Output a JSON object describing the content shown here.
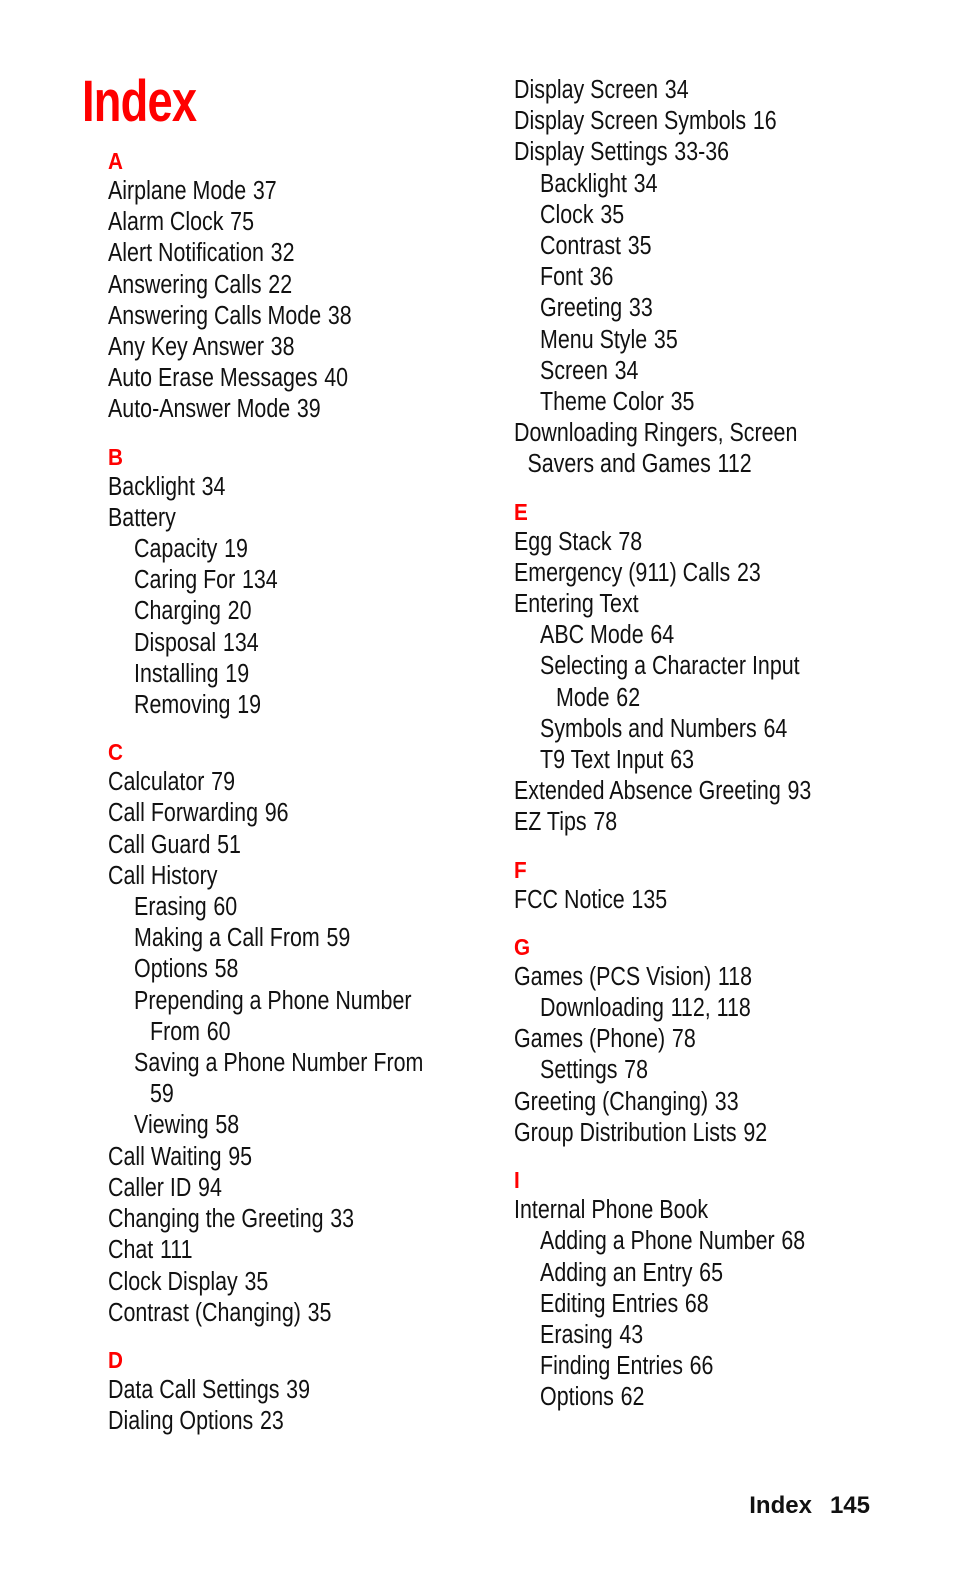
{
  "page": {
    "title": "Index",
    "accent_color": "#ff0000",
    "footer": {
      "section": "Index",
      "page_number": "145"
    }
  },
  "left_column": [
    {
      "letter": "A",
      "entries": [
        {
          "term": "Airplane Mode",
          "pages": "37",
          "level": 0
        },
        {
          "term": "Alarm Clock",
          "pages": "75",
          "level": 0
        },
        {
          "term": "Alert Notification",
          "pages": "32",
          "level": 0
        },
        {
          "term": "Answering Calls",
          "pages": "22",
          "level": 0
        },
        {
          "term": "Answering Calls Mode",
          "pages": "38",
          "level": 0
        },
        {
          "term": "Any Key Answer",
          "pages": "38",
          "level": 0
        },
        {
          "term": "Auto Erase Messages",
          "pages": "40",
          "level": 0
        },
        {
          "term": "Auto-Answer Mode",
          "pages": "39",
          "level": 0
        }
      ]
    },
    {
      "letter": "B",
      "entries": [
        {
          "term": "Backlight",
          "pages": "34",
          "level": 0
        },
        {
          "term": "Battery",
          "pages": "",
          "level": 0
        },
        {
          "term": "Capacity",
          "pages": "19",
          "level": 1
        },
        {
          "term": "Caring For",
          "pages": "134",
          "level": 1
        },
        {
          "term": "Charging",
          "pages": "20",
          "level": 1
        },
        {
          "term": "Disposal",
          "pages": "134",
          "level": 1
        },
        {
          "term": "Installing",
          "pages": "19",
          "level": 1
        },
        {
          "term": "Removing",
          "pages": "19",
          "level": 1
        }
      ]
    },
    {
      "letter": "C",
      "entries": [
        {
          "term": "Calculator",
          "pages": "79",
          "level": 0
        },
        {
          "term": "Call Forwarding",
          "pages": "96",
          "level": 0
        },
        {
          "term": "Call Guard",
          "pages": "51",
          "level": 0
        },
        {
          "term": "Call History",
          "pages": "",
          "level": 0
        },
        {
          "term": "Erasing",
          "pages": "60",
          "level": 1
        },
        {
          "term": "Making a Call From",
          "pages": "59",
          "level": 1
        },
        {
          "term": "Options",
          "pages": "58",
          "level": 1
        },
        {
          "term": "Prepending a Phone Number",
          "cont": "From",
          "pages": "60",
          "level": 1
        },
        {
          "term": "Saving a Phone Number From",
          "cont": "",
          "pages": "59",
          "level": 1
        },
        {
          "term": "Viewing",
          "pages": "58",
          "level": 1
        },
        {
          "term": "Call Waiting",
          "pages": "95",
          "level": 0
        },
        {
          "term": "Caller ID",
          "pages": "94",
          "level": 0
        },
        {
          "term": "Changing the Greeting",
          "pages": "33",
          "level": 0
        },
        {
          "term": "Chat",
          "pages": "111",
          "level": 0
        },
        {
          "term": "Clock Display",
          "pages": "35",
          "level": 0
        },
        {
          "term": "Contrast (Changing)",
          "pages": "35",
          "level": 0
        }
      ]
    },
    {
      "letter": "D",
      "entries": [
        {
          "term": "Data Call Settings",
          "pages": "39",
          "level": 0
        },
        {
          "term": "Dialing Options",
          "pages": "23",
          "level": 0
        }
      ]
    }
  ],
  "right_column": [
    {
      "letter": "",
      "entries": [
        {
          "term": "Display Screen",
          "pages": "34",
          "level": 0
        },
        {
          "term": "Display Screen Symbols",
          "pages": "16",
          "level": 0
        },
        {
          "term": "Display Settings",
          "pages": "33-36",
          "level": 0
        },
        {
          "term": "Backlight",
          "pages": "34",
          "level": 1
        },
        {
          "term": "Clock",
          "pages": "35",
          "level": 1
        },
        {
          "term": "Contrast",
          "pages": "35",
          "level": 1
        },
        {
          "term": "Font",
          "pages": "36",
          "level": 1
        },
        {
          "term": "Greeting",
          "pages": "33",
          "level": 1
        },
        {
          "term": "Menu Style",
          "pages": "35",
          "level": 1
        },
        {
          "term": "Screen",
          "pages": "34",
          "level": 1
        },
        {
          "term": "Theme Color",
          "pages": "35",
          "level": 1
        },
        {
          "term": "Downloading Ringers, Screen",
          "cont": "Savers and Games",
          "pages": "112",
          "level": 0
        }
      ]
    },
    {
      "letter": "E",
      "entries": [
        {
          "term": "Egg Stack",
          "pages": "78",
          "level": 0
        },
        {
          "term": "Emergency (911) Calls",
          "pages": "23",
          "level": 0
        },
        {
          "term": "Entering Text",
          "pages": "",
          "level": 0
        },
        {
          "term": "ABC Mode",
          "pages": "64",
          "level": 1
        },
        {
          "term": "Selecting a Character Input",
          "cont": "Mode",
          "pages": "62",
          "level": 1
        },
        {
          "term": "Symbols and Numbers",
          "pages": "64",
          "level": 1
        },
        {
          "term": "T9 Text Input",
          "pages": "63",
          "level": 1
        },
        {
          "term": "Extended Absence Greeting",
          "pages": "93",
          "level": 0
        },
        {
          "term": "EZ Tips",
          "pages": "78",
          "level": 0
        }
      ]
    },
    {
      "letter": "F",
      "entries": [
        {
          "term": "FCC Notice",
          "pages": "135",
          "level": 0
        }
      ]
    },
    {
      "letter": "G",
      "entries": [
        {
          "term": "Games (PCS Vision)",
          "pages": "118",
          "level": 0
        },
        {
          "term": "Downloading",
          "pages": "112, 118",
          "level": 1
        },
        {
          "term": "Games (Phone)",
          "pages": "78",
          "level": 0
        },
        {
          "term": "Settings",
          "pages": "78",
          "level": 1
        },
        {
          "term": "Greeting (Changing)",
          "pages": "33",
          "level": 0
        },
        {
          "term": "Group Distribution Lists",
          "pages": "92",
          "level": 0
        }
      ]
    },
    {
      "letter": "I",
      "entries": [
        {
          "term": "Internal Phone Book",
          "pages": "",
          "level": 0
        },
        {
          "term": "Adding a Phone Number",
          "pages": "68",
          "level": 1
        },
        {
          "term": "Adding an Entry",
          "pages": "65",
          "level": 1
        },
        {
          "term": "Editing Entries",
          "pages": "68",
          "level": 1
        },
        {
          "term": "Erasing",
          "pages": "43",
          "level": 1
        },
        {
          "term": "Finding Entries",
          "pages": "66",
          "level": 1
        },
        {
          "term": "Options",
          "pages": "62",
          "level": 1
        }
      ]
    }
  ]
}
